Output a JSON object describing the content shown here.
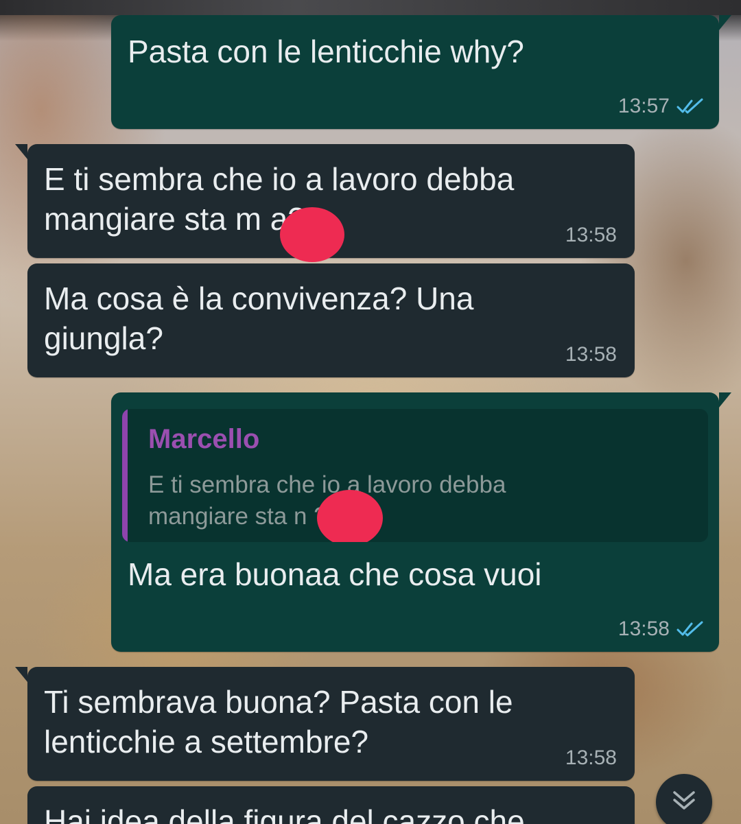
{
  "messages": [
    {
      "direction": "outgoing",
      "text": "Pasta con le lenticchie why?",
      "time": "13:57",
      "status": "read"
    },
    {
      "direction": "incoming",
      "text": "E ti sembra che io a lavoro debba\nmangiare sta m    a?",
      "time": "13:58"
    },
    {
      "direction": "incoming",
      "text": "Ma cosa è la convivenza? Una\ngiungla?",
      "time": "13:58"
    },
    {
      "direction": "outgoing",
      "quote": {
        "author": "Marcello",
        "text": "E ti sembra che io a lavoro debba\nmangiare sta n      ?"
      },
      "text": "Ma era buonaa che cosa vuoi",
      "time": "13:58",
      "status": "read"
    },
    {
      "direction": "incoming",
      "text": "Ti sembrava buona? Pasta con le\nlenticchie a settembre?",
      "time": "13:58"
    },
    {
      "direction": "incoming",
      "text": "Hai idea della figura del cazzo che",
      "time": ""
    }
  ],
  "colors": {
    "outgoing_bubble": "#0b3f3a",
    "incoming_bubble": "#1f2a30",
    "read_ticks": "#53bdeb",
    "quote_author": "#9b4fb0",
    "redaction": "#ee2b52"
  },
  "icons": {
    "read_receipt": "double-check-icon",
    "scroll_down": "double-chevron-down-icon"
  }
}
